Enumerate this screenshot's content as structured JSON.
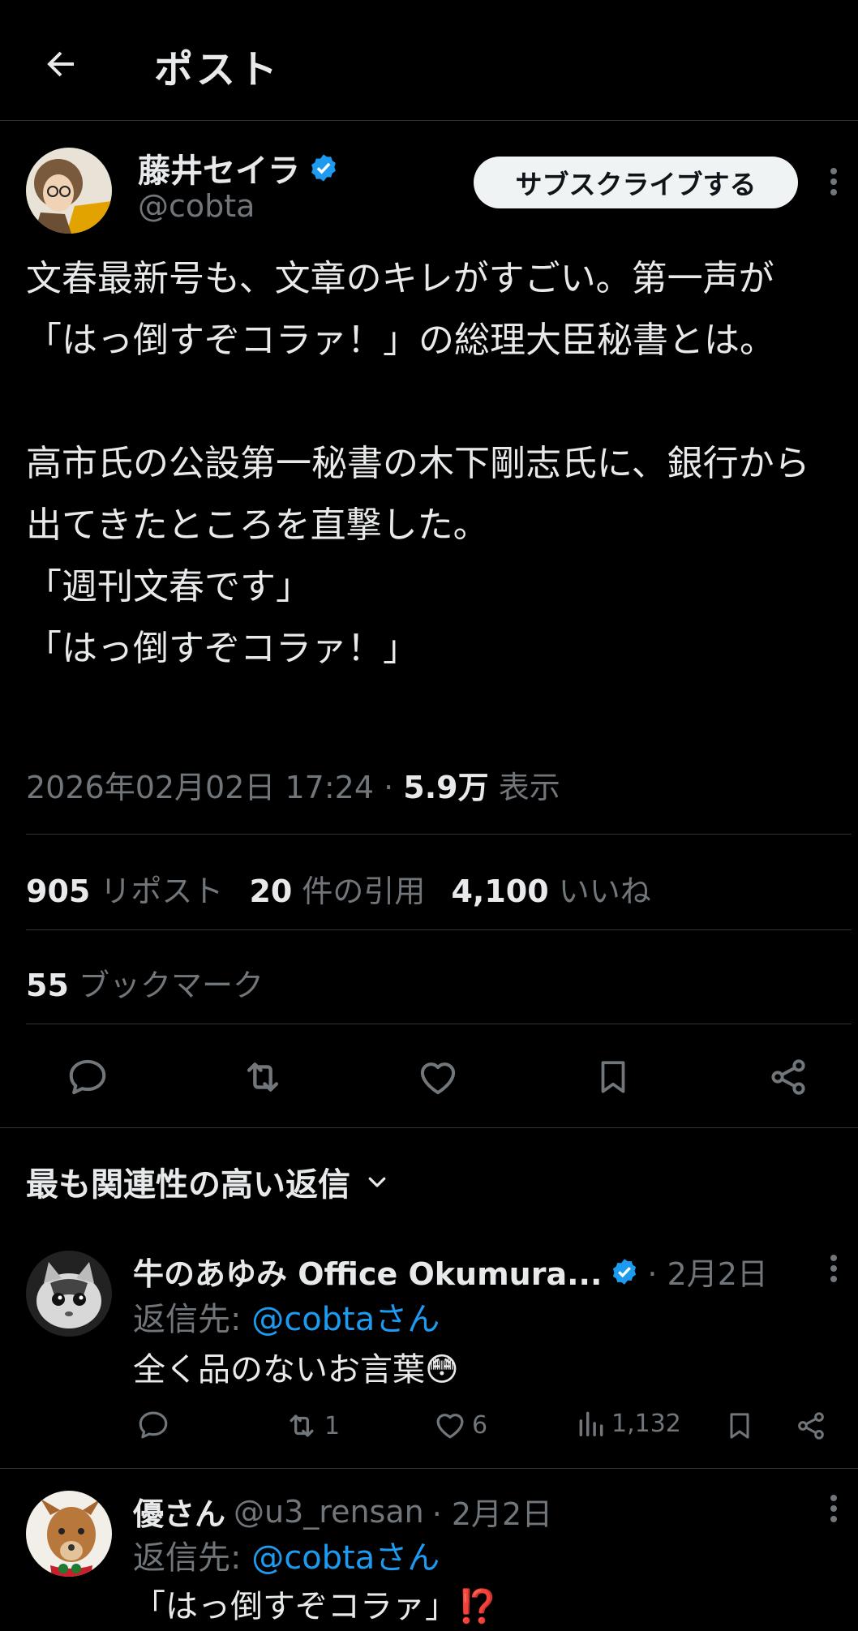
{
  "header": {
    "title": "ポスト"
  },
  "post": {
    "author_name": "藤井セイラ",
    "author_handle": "@cobta",
    "subscribe_label": "サブスクライブする",
    "body": "文春最新号も、文章のキレがすごい。第一声が「はっ倒すぞコラァ！」の総理大臣秘書とは。\n\n高市氏の公設第一秘書の木下剛志氏に、銀行から出てきたところを直撃した。\n「週刊文春です」\n「はっ倒すぞコラァ！」",
    "timestamp": "2026年02月02日 17:24",
    "separator": "·",
    "views_count": "5.9万",
    "views_label": "表示",
    "reposts_count": "905",
    "reposts_label": "リポスト",
    "quotes_count": "20",
    "quotes_label": "件の引用",
    "likes_count": "4,100",
    "likes_label": "いいね",
    "bookmarks_count": "55",
    "bookmarks_label": "ブックマーク"
  },
  "replies_sort_label": "最も関連性の高い返信",
  "replies": [
    {
      "name": "牛のあゆみ Office Okumura...",
      "handle": "",
      "date": "· 2月2日",
      "reply_prefix": "返信先: ",
      "reply_to": "@cobtaさん",
      "text": "全く品のないお言葉😳",
      "reposts": "1",
      "likes": "6",
      "views": "1,132"
    },
    {
      "name": "優さん",
      "handle": "@u3_rensan",
      "date": "· 2月2日",
      "reply_prefix": "返信先: ",
      "reply_to": "@cobtaさん",
      "text": "「はっ倒すぞコラァ」⁉️"
    }
  ],
  "colors": {
    "accent": "#1d9bf0",
    "background": "#000000",
    "text": "#e7e9ea",
    "muted": "#71767b",
    "divider": "#2f3336"
  },
  "icons": [
    "back-arrow-icon",
    "verified-badge-icon",
    "more-icon",
    "reply-icon",
    "repost-icon",
    "like-icon",
    "bookmark-icon",
    "share-icon",
    "chevron-down-icon",
    "views-icon"
  ]
}
